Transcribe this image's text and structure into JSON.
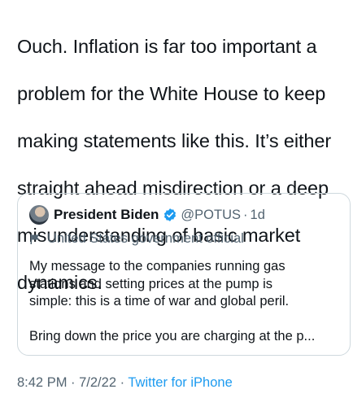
{
  "tweet": {
    "text_lines": [
      "Ouch. Inflation is far too important a",
      "problem for the White House to keep",
      "making statements like this. It’s either",
      "straight ahead misdirection or a deep",
      "misunderstanding of basic market",
      "dynamics."
    ]
  },
  "quoted_tweet": {
    "display_name": "President Biden",
    "handle": "@POTUS",
    "separator": "·",
    "age": "1d",
    "affiliation": "United States government official",
    "paragraph_1_lines": [
      "My message to the companies running gas",
      "stations and setting prices at the pump is",
      "simple: this is a time of war and global peril."
    ],
    "paragraph_2": "Bring down the price you are charging at the p...",
    "icons": {
      "verified": "verified-badge-icon",
      "affiliation": "flag-icon"
    },
    "colors": {
      "verified": "#1d9bf0",
      "border": "#cfd9de",
      "secondary_text": "#536471"
    }
  },
  "meta": {
    "time": "8:42 PM",
    "separator": " · ",
    "date": "7/2/22",
    "source": "Twitter for iPhone"
  },
  "colors": {
    "text": "#0f1419",
    "link": "#1d9bf0",
    "background": "#ffffff"
  }
}
